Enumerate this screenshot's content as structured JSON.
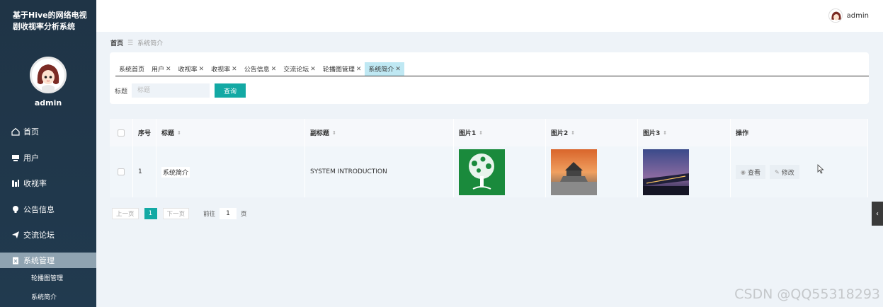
{
  "sidebar": {
    "title": "基于Hive的网络电视剧收视率分析系统",
    "username": "admin",
    "items": [
      {
        "label": "首页",
        "icon": "home-icon"
      },
      {
        "label": "用户",
        "icon": "user-card-icon"
      },
      {
        "label": "收视率",
        "icon": "bars-icon"
      },
      {
        "label": "公告信息",
        "icon": "bulb-icon"
      },
      {
        "label": "交流论坛",
        "icon": "paper-plane-icon"
      },
      {
        "label": "系统管理",
        "icon": "clipboard-icon"
      }
    ],
    "subitems": [
      {
        "label": "轮播图管理"
      },
      {
        "label": "系统简介"
      }
    ]
  },
  "header": {
    "username": "admin"
  },
  "breadcrumb": {
    "home": "首页",
    "current": "系统简介"
  },
  "tabs": [
    {
      "label": "系统首页",
      "closable": false
    },
    {
      "label": "用户",
      "closable": true
    },
    {
      "label": "收视率",
      "closable": true
    },
    {
      "label": "收视率",
      "closable": true
    },
    {
      "label": "公告信息",
      "closable": true
    },
    {
      "label": "交流论坛",
      "closable": true
    },
    {
      "label": "轮播图管理",
      "closable": true
    },
    {
      "label": "系统简介",
      "closable": true,
      "active": true
    }
  ],
  "search": {
    "label": "标题",
    "placeholder": "标题",
    "button": "查询"
  },
  "table": {
    "headers": {
      "index": "序号",
      "title": "标题",
      "subtitle": "副标题",
      "pic1": "图片1",
      "pic2": "图片2",
      "pic3": "图片3",
      "actions": "操作"
    },
    "rows": [
      {
        "index": "1",
        "title": "系统简介",
        "subtitle": "SYSTEM INTRODUCTION",
        "view": "查看",
        "edit": "修改"
      }
    ]
  },
  "pager": {
    "prev": "上一页",
    "current": "1",
    "next": "下一页",
    "goto_label": "前往",
    "goto_value": "1",
    "page_suffix": "页"
  },
  "watermark": "CSDN @QQ55318293",
  "colors": {
    "accent": "#13a9a4",
    "sidebar": "#1f3446",
    "active_tab": "#bfe8f3"
  }
}
